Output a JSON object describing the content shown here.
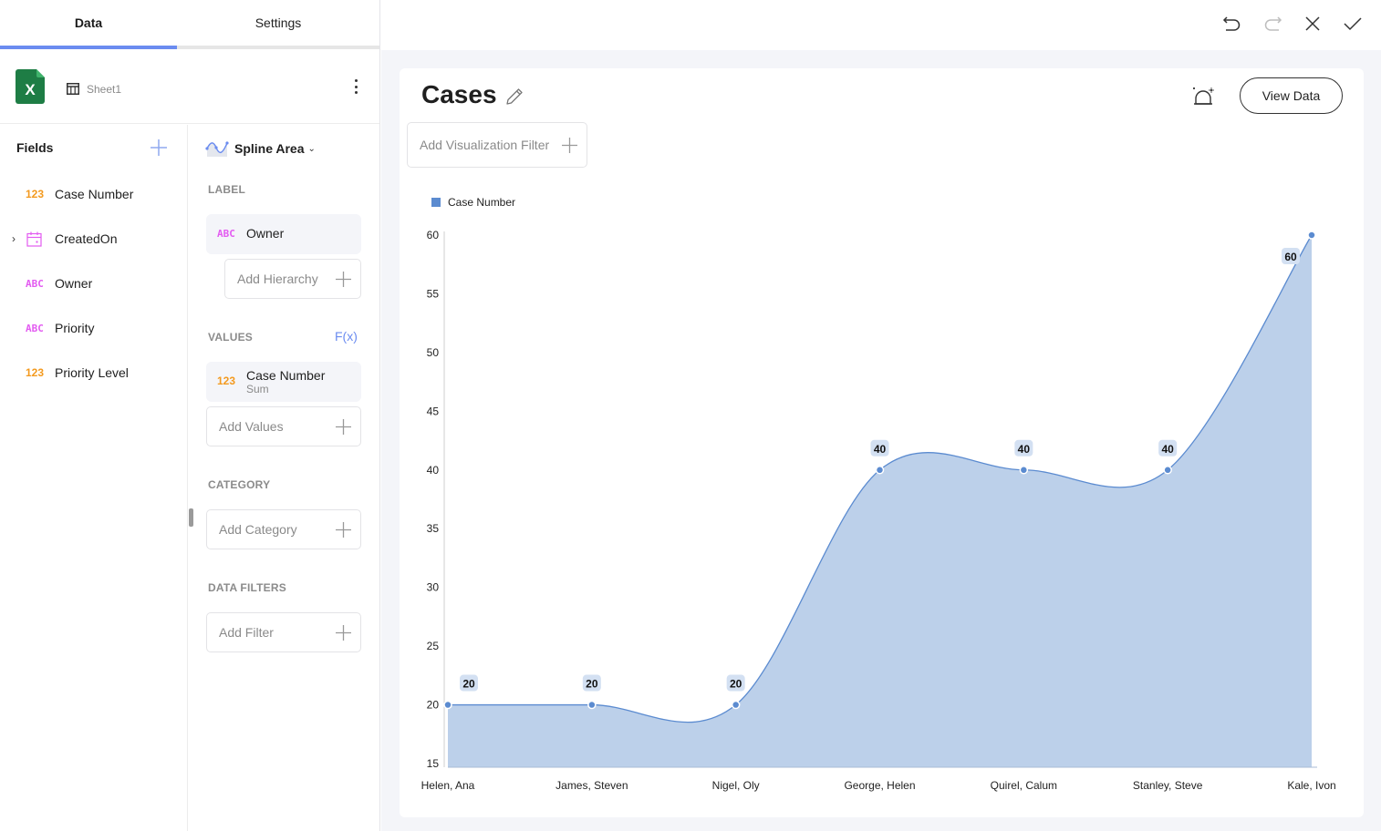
{
  "tabs": [
    {
      "label": "Data",
      "active": true
    },
    {
      "label": "Settings",
      "active": false
    }
  ],
  "source": {
    "icon": "excel-icon",
    "sheet_name": "Sheet1"
  },
  "fields": {
    "title": "Fields",
    "items": [
      {
        "type_label": "123",
        "type": "number",
        "name": "Case Number",
        "expandable": false
      },
      {
        "type_label": "",
        "type": "date",
        "name": "CreatedOn",
        "expandable": true
      },
      {
        "type_label": "ABC",
        "type": "text",
        "name": "Owner",
        "expandable": false
      },
      {
        "type_label": "ABC",
        "type": "text",
        "name": "Priority",
        "expandable": false
      },
      {
        "type_label": "123",
        "type": "number",
        "name": "Priority Level",
        "expandable": false
      }
    ]
  },
  "config": {
    "chart_type": "Spline Area",
    "label_section": "LABEL",
    "label_pill": {
      "type_label": "ABC",
      "name": "Owner"
    },
    "add_hierarchy": "Add Hierarchy",
    "values_section": "VALUES",
    "fx_label": "F(x)",
    "values_pill": {
      "type_label": "123",
      "name": "Case Number",
      "sub": "Sum"
    },
    "add_values": "Add Values",
    "category_section": "CATEGORY",
    "add_category": "Add Category",
    "filters_section": "DATA FILTERS",
    "add_filter": "Add Filter"
  },
  "toolbar": {
    "undo": "undo-icon",
    "redo": "redo-icon",
    "close": "close-icon",
    "confirm": "check-icon"
  },
  "viz": {
    "title": "Cases",
    "view_data_label": "View Data",
    "add_viz_filter": "Add Visualization Filter"
  },
  "colors": {
    "accent": "#6b8cf0",
    "series": "#5b8bd0",
    "area_fill": "#bcd0ea",
    "number_type": "#f39a1f",
    "text_type": "#e35cf1"
  },
  "chart_data": {
    "type": "area",
    "subtype": "spline",
    "title": "Cases",
    "xlabel": "",
    "ylabel": "",
    "categories": [
      "Helen, Ana",
      "James, Steven",
      "Nigel, Oly",
      "George, Helen",
      "Quirel, Calum",
      "Stanley, Steve",
      "Kale, Ivon"
    ],
    "series": [
      {
        "name": "Case Number",
        "values": [
          20,
          20,
          20,
          40,
          40,
          40,
          60
        ]
      }
    ],
    "ylim": [
      15,
      60
    ],
    "yticks": [
      15,
      20,
      25,
      30,
      35,
      40,
      45,
      50,
      55,
      60
    ],
    "grid": false,
    "legend": "top-left",
    "data_labels": true
  }
}
